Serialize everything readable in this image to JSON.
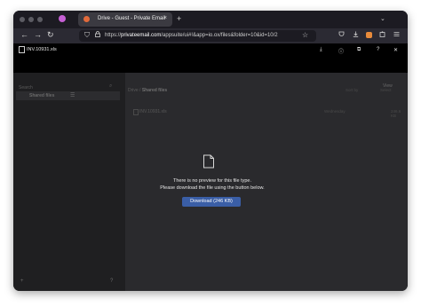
{
  "browser": {
    "tab": {
      "title": "Drive - Guest - Private Email",
      "close": "×"
    },
    "new_tab": "+",
    "tab_list": "⌄",
    "nav": {
      "back": "←",
      "forward": "→",
      "reload": "↻"
    },
    "url": {
      "scheme": "https://",
      "host": "privateemail.com",
      "path": "/appsuite/ui#!&app=io.ox/files&folder=10&id=10/2"
    },
    "icons": {
      "shield": "⛉",
      "lock": "🔒",
      "star": "☆"
    }
  },
  "app": {
    "file_name": "INV.10931.xls",
    "actions": {
      "download": "⤓",
      "info": "ⓘ",
      "popout": "⧉",
      "help": "?",
      "close": "✕"
    }
  },
  "sidebar": {
    "search_placeholder": "Search",
    "folder": "Shared files",
    "footer_left": "+",
    "footer_right": "?"
  },
  "main": {
    "breadcrumb": {
      "root": "Drive",
      "current": "Shared files"
    },
    "view_label": "View",
    "sort": {
      "by": "Sort by",
      "select": "Select"
    },
    "rows": [
      {
        "name": "INV.10931.xls",
        "date": "Wednesday",
        "size": "246.6 KB"
      }
    ]
  },
  "preview": {
    "line1": "There is no preview for this file type.",
    "line2": "Please download the file using the button below.",
    "button": "Download (246 KB)"
  },
  "colors": {
    "accent": "#3a5ea6",
    "tab_favicon": "#e26a3b",
    "private_mask": "#c55fd4"
  }
}
